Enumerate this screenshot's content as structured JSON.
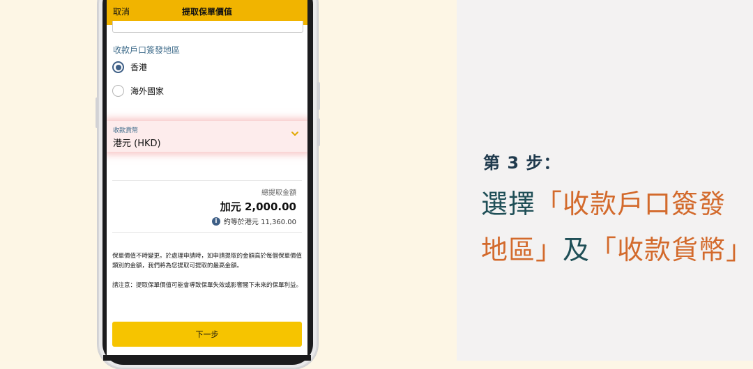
{
  "header": {
    "cancel_label": "取消",
    "title": "提取保單價值"
  },
  "account_region": {
    "label": "收款戶口簽發地區",
    "options": [
      {
        "label": "香港",
        "selected": true
      },
      {
        "label": "海外國家",
        "selected": false
      }
    ]
  },
  "currency": {
    "label": "收款貨幣",
    "value": "港元 (HKD)",
    "chevron_icon": "chevron-down-icon"
  },
  "total": {
    "label": "總提取金額",
    "amount": "加元 2,000.00",
    "approx": "約等於港元 11,360.00",
    "info_icon": "info-icon"
  },
  "notes": {
    "line1": "保單價值不時變更。於處理申請時，如申請提取的金額高於每個保單價值類別的金額，我們將為您提取可提取的最高金額。",
    "line2": "請注意：提取保單價值可能會導致保單失效或影響閣下未來的保單利益。"
  },
  "next_button_label": "下一步",
  "instruction": {
    "step": "第 3 步：",
    "line1_a": "選擇",
    "line1_b": "「收款戶口簽發",
    "line2_a": "地區」",
    "line2_b": "及",
    "line2_c": "「收款貨幣」"
  },
  "colors": {
    "header_yellow": "#f1b400",
    "button_yellow": "#f6c400",
    "accent_blue": "#3e5f86",
    "highlight_orange": "#d36a2c",
    "heading_teal": "#1f4f57"
  }
}
